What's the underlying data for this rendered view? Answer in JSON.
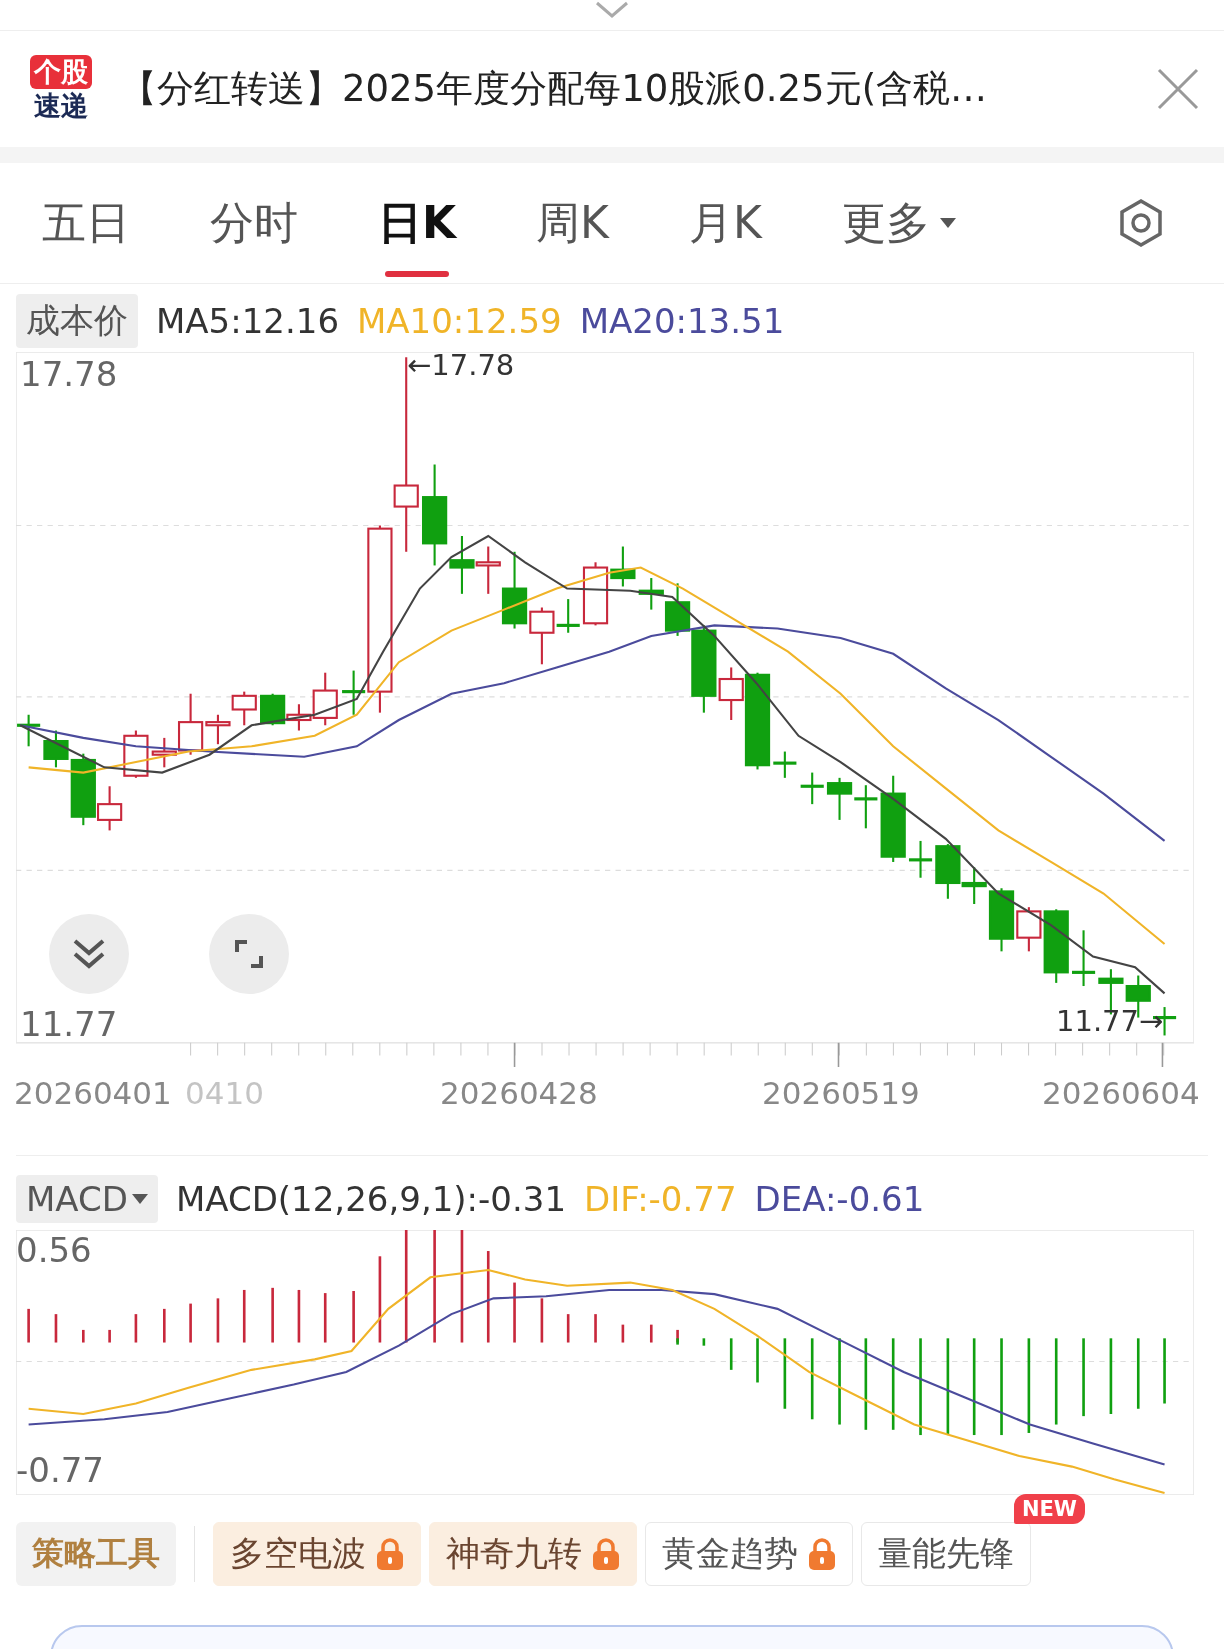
{
  "banner": {
    "logo_top": "个股",
    "logo_bottom": "速递",
    "title": "【分红转送】2025年度分配每10股派0.25元(含税…"
  },
  "tabs": [
    {
      "label": "五日",
      "selected": false,
      "kind": "plain"
    },
    {
      "label": "分时",
      "selected": false,
      "kind": "plain"
    },
    {
      "label": "日K",
      "selected": true,
      "kind": "plain"
    },
    {
      "label": "周K",
      "selected": false,
      "kind": "plain"
    },
    {
      "label": "月K",
      "selected": false,
      "kind": "plain"
    },
    {
      "label": "更多",
      "selected": false,
      "kind": "dropdown"
    }
  ],
  "indicator_bar": {
    "button": "成本价",
    "items": [
      {
        "text": "MA5:12.16",
        "color": "#333333"
      },
      {
        "text": "MA10:12.59",
        "color": "#f0b428"
      },
      {
        "text": "MA20:13.51",
        "color": "#4b4b9c"
      }
    ]
  },
  "price_chart": {
    "max_label": "17.78",
    "min_label": "11.77",
    "high_marker": "←17.78",
    "low_marker": "11.77→"
  },
  "dates": [
    {
      "text": "20260401",
      "faded": false
    },
    {
      "text": "0410",
      "faded": true
    },
    {
      "text": "20260428",
      "faded": false
    },
    {
      "text": "20260519",
      "faded": false
    },
    {
      "text": "20260604",
      "faded": false
    }
  ],
  "macd_bar": {
    "button": "MACD",
    "items": [
      {
        "text": "MACD(12,26,9,1):-0.31",
        "color": "#333333"
      },
      {
        "text": "DIF:-0.77",
        "color": "#f0b428"
      },
      {
        "text": "DEA:-0.61",
        "color": "#4b4b9c"
      }
    ]
  },
  "macd_chart": {
    "max_label": "0.56",
    "min_label": "-0.77"
  },
  "toolbar": {
    "title": "策略工具",
    "chips": [
      {
        "label": "多空电波",
        "locked": true,
        "highlighted": true
      },
      {
        "label": "神奇九转",
        "locked": true,
        "highlighted": true
      },
      {
        "label": "黄金趋势",
        "locked": true,
        "highlighted": false
      },
      {
        "label": "量能先锋",
        "locked": false,
        "highlighted": false,
        "badge": "NEW"
      }
    ]
  }
}
